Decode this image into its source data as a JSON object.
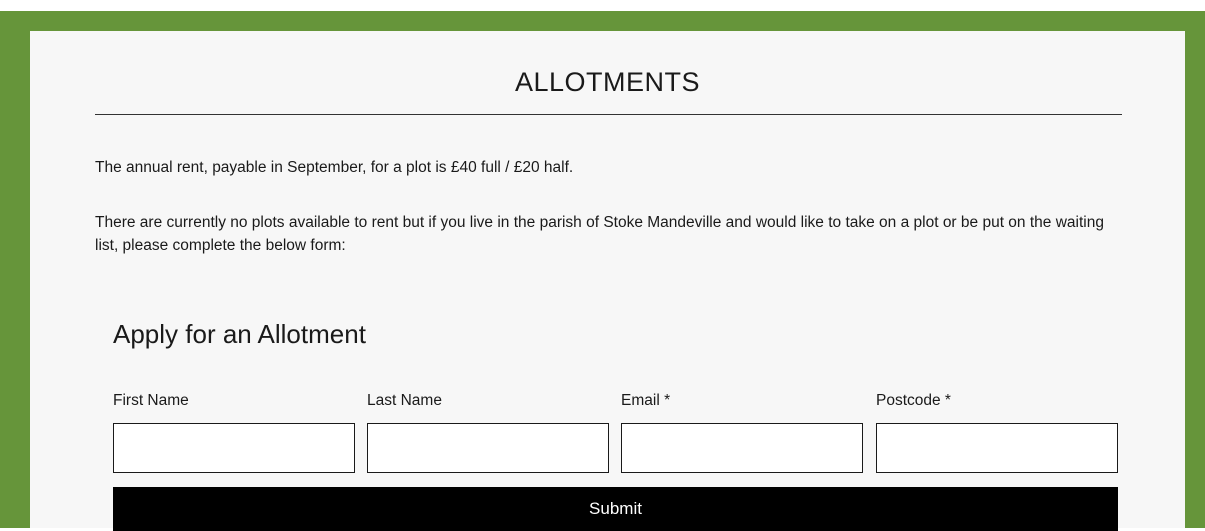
{
  "page": {
    "title": "ALLOTMENTS",
    "paragraph_1": "The annual rent, payable in September, for a plot is £40 full / £20 half.",
    "paragraph_2": "There are currently no plots available to rent but if you live in the parish of Stoke Mandeville and would like to take on a plot or be put on the waiting list, please complete the below form:"
  },
  "form": {
    "title": "Apply for an Allotment",
    "fields": [
      {
        "label": "First Name",
        "value": ""
      },
      {
        "label": "Last Name",
        "value": ""
      },
      {
        "label": "Email *",
        "value": ""
      },
      {
        "label": "Postcode *",
        "value": ""
      }
    ],
    "submit_label": "Submit"
  },
  "colors": {
    "frame_green": "#66953a",
    "panel_background": "#f7f7f7",
    "button_background": "#000000",
    "button_text": "#ffffff"
  }
}
